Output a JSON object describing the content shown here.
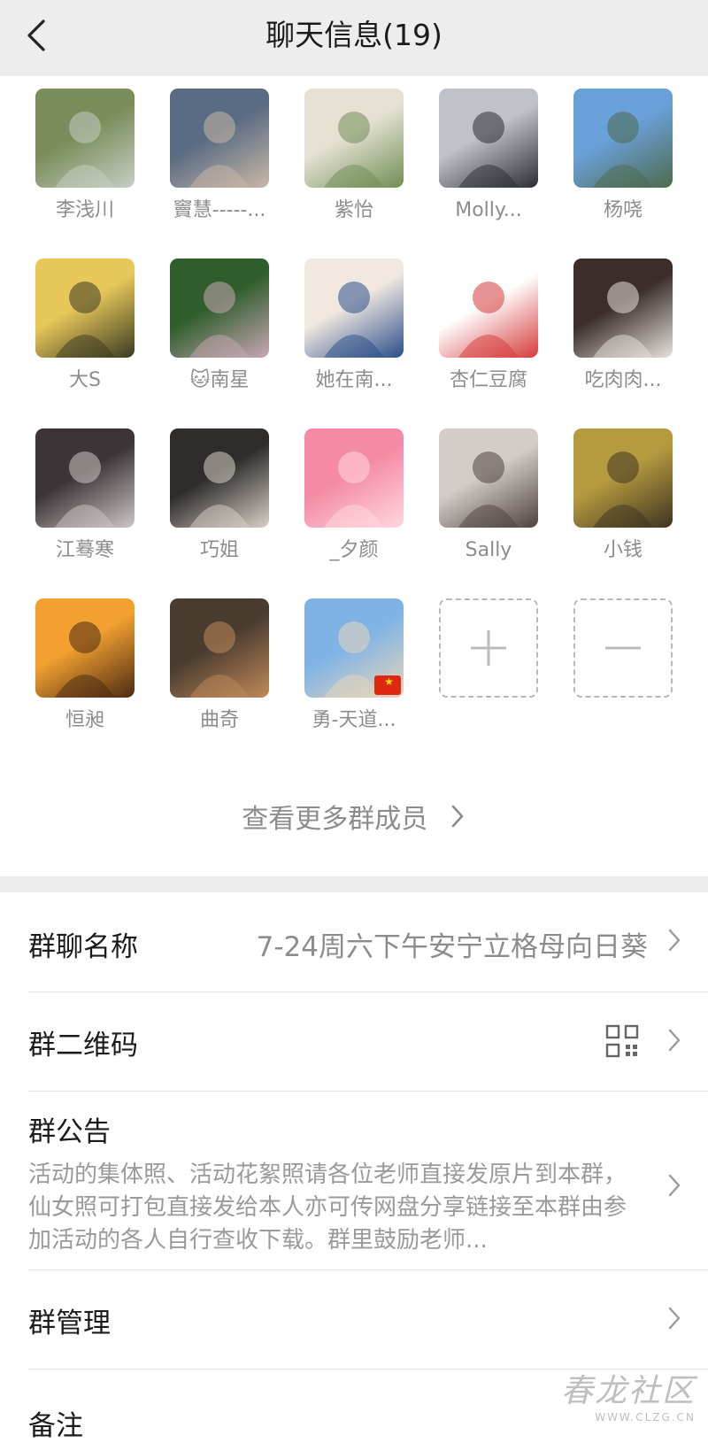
{
  "header": {
    "title": "聊天信息(19)"
  },
  "members": [
    {
      "name": "李浅川",
      "c1": "#7a8d5a",
      "c2": "#c7cec4"
    },
    {
      "name": "竇慧-----...",
      "c1": "#5a6b84",
      "c2": "#c9b8a6"
    },
    {
      "name": "紫怡",
      "c1": "#e6e1d3",
      "c2": "#6f8e55"
    },
    {
      "name": "Molly...",
      "c1": "#bfc2c6",
      "c2": "#2a2d33"
    },
    {
      "name": "杨哓",
      "c1": "#6aa0d8",
      "c2": "#4e6a4c"
    },
    {
      "name": "大S",
      "c1": "#e8c85a",
      "c2": "#3a3a22"
    },
    {
      "name": "🐱南星",
      "c1": "#2f5e2c",
      "c2": "#c9a7b6"
    },
    {
      "name": "她在南...",
      "c1": "#f1e8e0",
      "c2": "#2a4e8a"
    },
    {
      "name": "杏仁豆腐",
      "c1": "#ffffff",
      "c2": "#d63a3a"
    },
    {
      "name": "吃肉肉...",
      "c1": "#3b2e2a",
      "c2": "#e7e2dd"
    },
    {
      "name": "江蓦寒",
      "c1": "#3c3436",
      "c2": "#d0c6c7"
    },
    {
      "name": "巧姐",
      "c1": "#2f2c2b",
      "c2": "#d9d1c8"
    },
    {
      "name": "_夕颜",
      "c1": "#f48aa4",
      "c2": "#ffd7e0"
    },
    {
      "name": "Sally",
      "c1": "#d2cdc9",
      "c2": "#4e423d"
    },
    {
      "name": "小钱",
      "c1": "#b59b3f",
      "c2": "#3f3322"
    },
    {
      "name": "恒昶",
      "c1": "#f2a030",
      "c2": "#4a2a12"
    },
    {
      "name": "曲奇",
      "c1": "#4a3b2f",
      "c2": "#c08a5a"
    },
    {
      "name": "勇-天道...",
      "c1": "#7fb3e6",
      "c2": "#e7d6b9"
    }
  ],
  "more_members": "查看更多群成员",
  "settings": {
    "group_name_label": "群聊名称",
    "group_name_value": "7-24周六下午安宁立格母向日葵",
    "qrcode_label": "群二维码",
    "notice_label": "群公告",
    "notice_text": "活动的集体照、活动花絮照请各位老师直接发原片到本群，仙女照可打包直接发给本人亦可传网盘分享链接至本群由参加活动的各人自行查收下载。群里鼓励老师...",
    "manage_label": "群管理",
    "remark_label": "备注"
  },
  "watermark": {
    "text": "春龙社区",
    "url": "WWW.CLZG.CN"
  },
  "colors": {
    "header_bg": "#ededed",
    "muted_text": "#8c8c8c",
    "separator": "#ededed"
  }
}
